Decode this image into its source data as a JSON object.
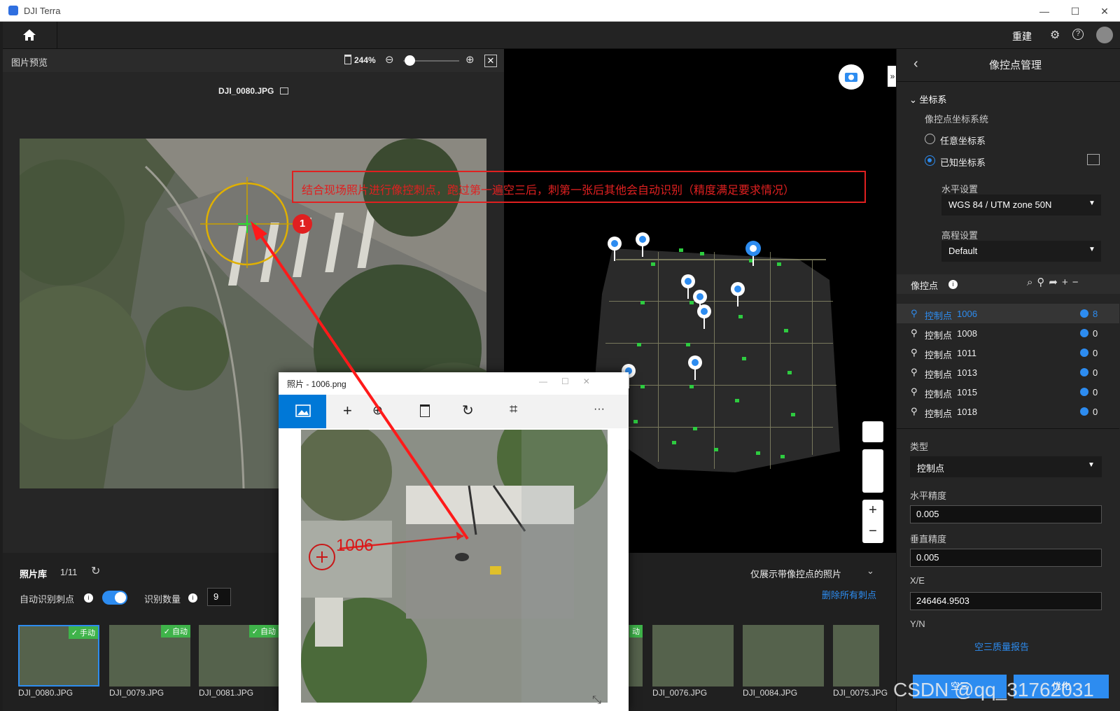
{
  "window": {
    "title": "DJI Terra",
    "min": "—",
    "max": "☐",
    "close": "✕"
  },
  "appbar": {
    "home_icon": "home-icon",
    "rebuild": "重建"
  },
  "preview": {
    "title": "图片预览",
    "zoom": "244%",
    "filename": "DJI_0080.JPG"
  },
  "annotation": {
    "text": "结合现场照片进行像控刺点，跑过第一遍空三后，刺第一张后其他会自动识别（精度满足要求情况）",
    "badge": "1"
  },
  "photos_app": {
    "title": "照片 - 1006.png",
    "label": "1006",
    "more": "···"
  },
  "gallery": {
    "title": "照片库",
    "count": "1/11",
    "auto_label": "自动识别刺点",
    "recog_label": "识别数量",
    "recog_value": "9",
    "filter": "仅展示带像控点的照片",
    "delete_all": "删除所有刺点",
    "thumbs": [
      {
        "name": "DJI_0080.JPG",
        "tag": "✓ 手动"
      },
      {
        "name": "DJI_0079.JPG",
        "tag": "✓ 自动"
      },
      {
        "name": "DJI_0081.JPG",
        "tag": "✓ 自动"
      },
      {
        "name": "DJI_0076.JPG",
        "tag": ""
      },
      {
        "name": "DJI_0084.JPG",
        "tag": ""
      },
      {
        "name": "DJI_0075.JPG",
        "tag": ""
      }
    ],
    "partial_tag": "动"
  },
  "right": {
    "title": "像控点管理",
    "coord_section": "坐标系",
    "coord_system": "像控点坐标系统",
    "opt_any": "任意坐标系",
    "opt_known": "已知坐标系",
    "horiz": "水平设置",
    "horiz_val": "WGS 84 / UTM zone 50N",
    "elev": "高程设置",
    "elev_val": "Default",
    "gcp_title": "像控点",
    "gcps": [
      {
        "type": "控制点",
        "id": "1006",
        "count": "8"
      },
      {
        "type": "控制点",
        "id": "1008",
        "count": "0"
      },
      {
        "type": "控制点",
        "id": "1011",
        "count": "0"
      },
      {
        "type": "控制点",
        "id": "1013",
        "count": "0"
      },
      {
        "type": "控制点",
        "id": "1015",
        "count": "0"
      },
      {
        "type": "控制点",
        "id": "1018",
        "count": "0"
      }
    ],
    "type_label": "类型",
    "type_val": "控制点",
    "hacc_label": "水平精度",
    "hacc": "0.005",
    "vacc_label": "垂直精度",
    "vacc": "0.005",
    "xe_label": "X/E",
    "xe": "246464.9503",
    "yn_label": "Y/N",
    "report": "空三质量报告",
    "btn1": "空三",
    "btn2": "优化"
  },
  "watermark": "CSDN @qq_31762031"
}
